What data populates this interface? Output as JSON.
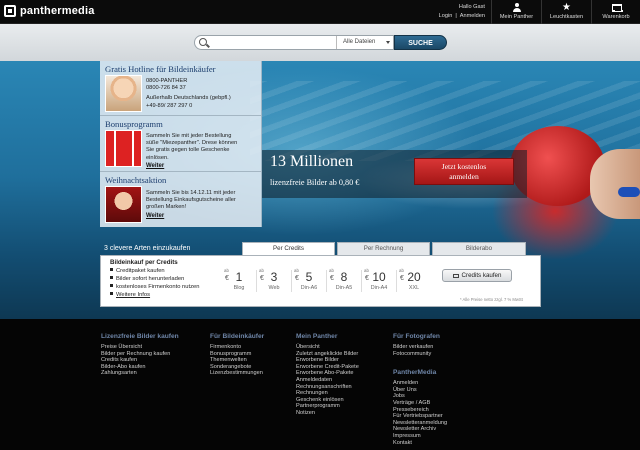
{
  "brand": {
    "name": "panthermedia"
  },
  "account": {
    "greeting": "Hallo Gast",
    "login": "Login",
    "separator": "|",
    "register": "Anmelden"
  },
  "nav": [
    {
      "label": "Mein Panther",
      "icon": "user-icon"
    },
    {
      "label": "Leuchtkasten",
      "icon": "star-icon"
    },
    {
      "label": "Warenkorb",
      "icon": "cart-icon"
    }
  ],
  "search": {
    "placeholder": "",
    "value": "",
    "scope": "Alle Dateien",
    "button": "SUCHE"
  },
  "side": {
    "hotline": {
      "title": "Gratis Hotline für Bildeinkäufer",
      "lines": [
        "0800-PANTHER",
        "0800-726 84 37",
        "",
        "Außerhalb Deutschlands (gebpfl.)",
        "+49-89/ 287 297 0"
      ]
    },
    "bonus": {
      "title": "Bonusprogramm",
      "lines": [
        "Sammeln Sie mit jeder Bestellung",
        "süße \"Miezepanther\". Drese können",
        "Sie gratis gegen tolle Geschenke",
        "einlösen."
      ],
      "link": "Weiter"
    },
    "xmas": {
      "title": "Weihnachtsaktion",
      "lines": [
        "Sammeln Sie bis 14.12.11 mit jeder",
        "Bestellung Einkaufsgutscheine aller",
        "großen Marken!"
      ],
      "link": "Weiter"
    }
  },
  "promo": {
    "headline": "13 Millionen",
    "sub": "lizenzfreie Bilder ab 0,80 €",
    "cta_line1": "Jetzt kostenlos",
    "cta_line2": "anmelden"
  },
  "ways": {
    "title": "3 clevere Arten einzukaufen",
    "tabs": [
      "Per Credits",
      "Per Rechnung",
      "Bilderabo"
    ],
    "card_title": "Bildeinkauf per Credits",
    "features": [
      "Creditpaket kaufen",
      "Bilder sofort herunterladen",
      "kostenloses Firmenkonto nutzen",
      "Weitere Infos"
    ],
    "prices": [
      {
        "prefix": "ab",
        "currency": "€",
        "value": "1",
        "label": "Blog"
      },
      {
        "prefix": "ab",
        "currency": "€",
        "value": "3",
        "label": "Web"
      },
      {
        "prefix": "ab",
        "currency": "€",
        "value": "5",
        "label": "Din-A6"
      },
      {
        "prefix": "ab",
        "currency": "€",
        "value": "8",
        "label": "Din-A5"
      },
      {
        "prefix": "ab",
        "currency": "€",
        "value": "10",
        "label": "Din-A4"
      },
      {
        "prefix": "ab",
        "currency": "€",
        "value": "20",
        "label": "XXL"
      }
    ],
    "button": "Credits kaufen",
    "note": "* Alle Preise netto zzgl. 7 % MwSt"
  },
  "footer": {
    "col1": {
      "title": "Lizenzfreie Bilder kaufen",
      "links": [
        "Preise Übersicht",
        "Bilder per Rechnung kaufen",
        "Credits kaufen",
        "Bilder-Abo kaufen",
        "Zahlungsarten"
      ]
    },
    "col2": {
      "title": "Für Bildeinkäufer",
      "links": [
        "Firmenkonto",
        "Bonusprogramm",
        "Themenwelten",
        "Sonderangebote",
        "Lizenzbestimmungen"
      ]
    },
    "col3": {
      "title": "Mein Panther",
      "links": [
        "Übersicht",
        "Zuletzt angeklickte Bilder",
        "Erworbene Bilder",
        "Erworbene Credit-Pakete",
        "Erworbene Abo-Pakete",
        "Anmeldedaten",
        "Rechnungsanschriften",
        "Rechnungen",
        "Geschenk einlösen",
        "Partnerprogramm",
        "Notizen"
      ]
    },
    "col4": {
      "title": "Für Fotografen",
      "links": [
        "Bilder verkaufen",
        "Fotocommunity"
      ]
    },
    "col5": {
      "title": "PantherMedia",
      "links": [
        "Anmelden",
        "Über Uns",
        "Jobs",
        "Verträge / AGB",
        "Pressebereich",
        "Für Vertriebspartner",
        "Newsletteranmeldung",
        "Newsletter Archiv",
        "Impressum",
        "Kontakt"
      ]
    }
  }
}
